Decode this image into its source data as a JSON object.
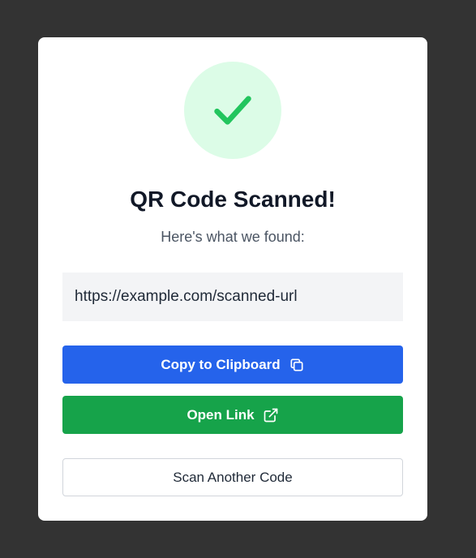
{
  "dialog": {
    "title": "QR Code Scanned!",
    "subtitle": "Here's what we found:",
    "scanned_url": "https://example.com/scanned-url",
    "status_icon": "checkmark-icon"
  },
  "actions": {
    "copy_label": "Copy to Clipboard",
    "copy_icon": "copy-icon",
    "open_label": "Open Link",
    "open_icon": "external-link-icon",
    "scan_again_label": "Scan Another Code"
  },
  "colors": {
    "backdrop": "#333333",
    "success_bg": "#dcfce7",
    "success_check": "#22c55e",
    "primary_blue": "#2563eb",
    "success_green": "#16a34a"
  }
}
